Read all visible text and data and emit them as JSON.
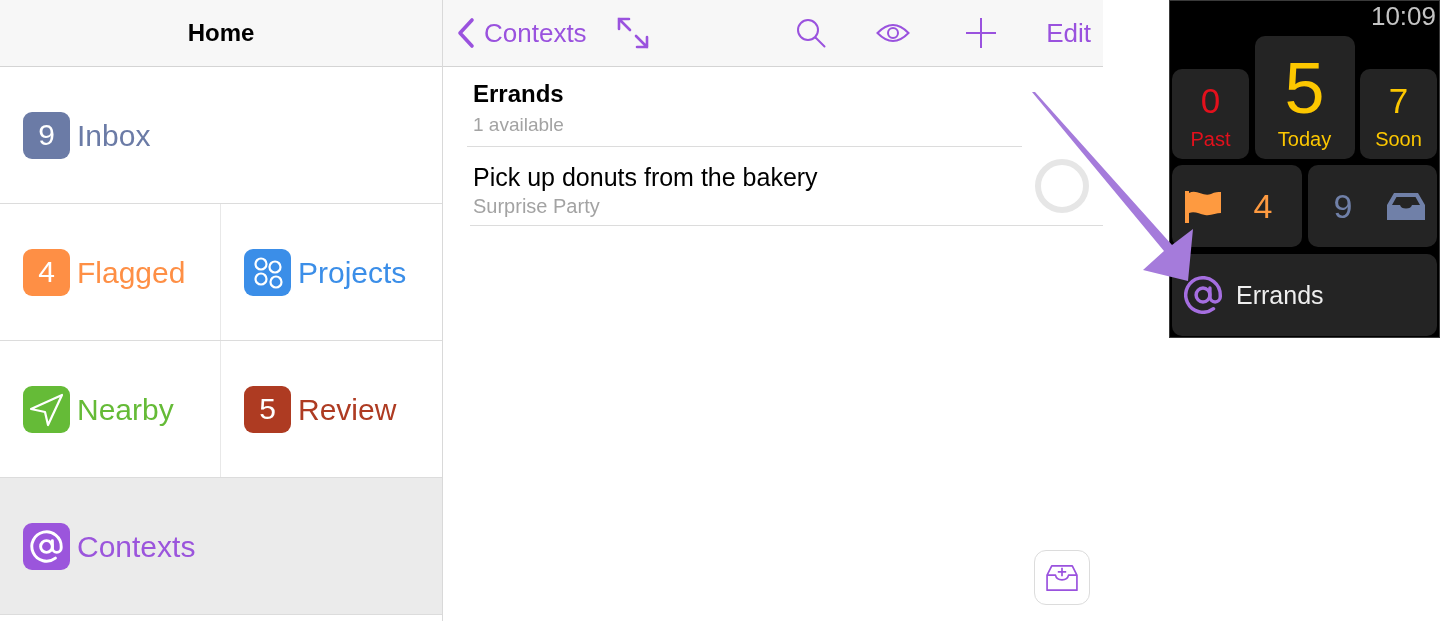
{
  "sidebar": {
    "title": "Home",
    "rows": [
      [
        {
          "kind": "count",
          "badge": "9",
          "label": "Inbox",
          "color": "#6b7ba6",
          "selected": false
        }
      ],
      [
        {
          "kind": "count",
          "badge": "4",
          "label": "Flagged",
          "color": "#fe8f45",
          "selected": false
        },
        {
          "kind": "projects",
          "label": "Projects",
          "color": "#3b8ee8",
          "selected": false
        }
      ],
      [
        {
          "kind": "nearby",
          "label": "Nearby",
          "color": "#65bb37",
          "selected": false
        },
        {
          "kind": "count",
          "badge": "5",
          "label": "Review",
          "color": "#ae3b22",
          "selected": false
        }
      ],
      [
        {
          "kind": "contexts",
          "label": "Contexts",
          "color": "#9b55dc",
          "selected": true
        }
      ]
    ]
  },
  "navigation": {
    "back_label": "Contexts",
    "edit_label": "Edit"
  },
  "context": {
    "title": "Errands",
    "subtitle": "1 available",
    "tasks": [
      {
        "title": "Pick up donuts from the bakery",
        "project": "Surprise Party",
        "checked": false
      }
    ]
  },
  "watch": {
    "time": "10:09",
    "forecast": [
      {
        "kind": "small",
        "count": "0",
        "label": "Past",
        "color": "#e3101c"
      },
      {
        "kind": "large",
        "count": "5",
        "label": "Today",
        "color": "#fcc700"
      },
      {
        "kind": "small",
        "count": "7",
        "label": "Soon",
        "color": "#fcc700"
      }
    ],
    "shortcuts": [
      {
        "kind": "flagged",
        "count": "4",
        "color": "#fe9a40"
      },
      {
        "kind": "inbox",
        "count": "9",
        "color": "#7080a8"
      }
    ],
    "context": {
      "label": "Errands"
    }
  }
}
